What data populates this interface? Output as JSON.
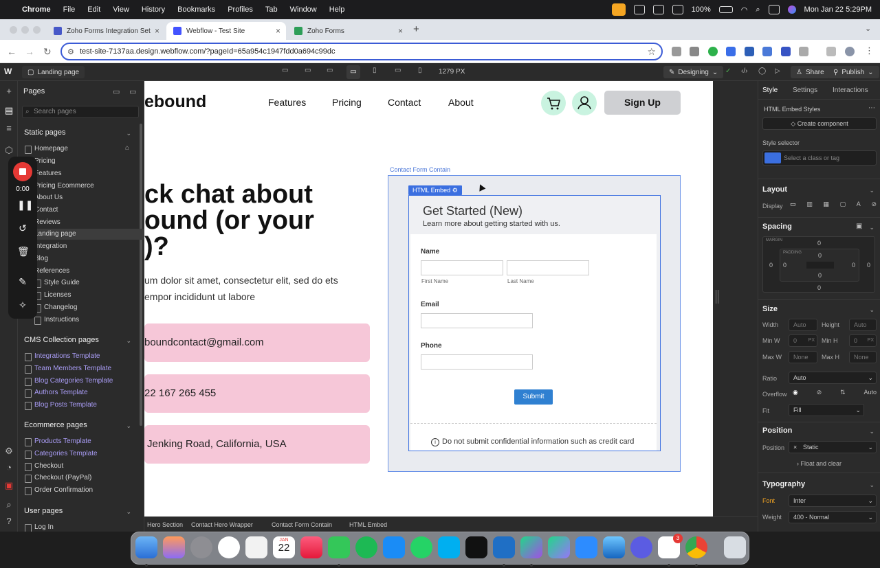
{
  "menubar": {
    "app": "Chrome",
    "items": [
      "File",
      "Edit",
      "View",
      "History",
      "Bookmarks",
      "Profiles",
      "Tab",
      "Window",
      "Help"
    ],
    "battery": "100%",
    "datetime": "Mon Jan 22  5:29PM"
  },
  "browser": {
    "tabs": [
      {
        "title": "Zoho Forms Integration Setup",
        "color": "#4758c8"
      },
      {
        "title": "Webflow - Test Site",
        "color": "#4353ff"
      },
      {
        "title": "Zoho Forms",
        "color": "#2e9e58"
      }
    ],
    "url": "test-site-7137aa.design.webflow.com/?pageId=65a954c1947fdd0a694c99dc"
  },
  "webflow_top": {
    "page": "Landing page",
    "width": "1279 PX",
    "mode": "Designing",
    "share": "Share",
    "publish": "Publish"
  },
  "pages_panel": {
    "title": "Pages",
    "search_placeholder": "Search pages",
    "static_title": "Static pages",
    "static": [
      "Homepage",
      "Pricing",
      "Features",
      "Pricing Ecommerce",
      "About Us",
      "Contact",
      "Reviews",
      "Landing page",
      "Integration",
      "Blog",
      "References"
    ],
    "static_sub": [
      "Style Guide",
      "Licenses",
      "Changelog",
      "Instructions"
    ],
    "cms_title": "CMS Collection pages",
    "cms": [
      "Integrations Template",
      "Team Members Template",
      "Blog Categories Template",
      "Authors Template",
      "Blog Posts Template"
    ],
    "ecom_title": "Ecommerce pages",
    "ecom_cms": [
      "Products Template",
      "Categories Template"
    ],
    "ecom": [
      "Checkout",
      "Checkout (PayPal)",
      "Order Confirmation"
    ],
    "user_title": "User pages",
    "user": [
      "Log In"
    ]
  },
  "recording": {
    "time": "0:00"
  },
  "site": {
    "logo": "ebound",
    "nav": [
      "Features",
      "Pricing",
      "Contact",
      "About"
    ],
    "signup": "Sign Up",
    "hero_lines": [
      "ck chat about",
      "ound (or your",
      ")?"
    ],
    "lorem_lines": [
      "um dolor sit amet, consectetur elit, sed do ets",
      "empor incididunt ut labore"
    ],
    "cards": [
      "boundcontact@gmail.com",
      "22 167 265 455",
      "Jenking Road, California, USA"
    ],
    "container_label": "Contact Form Contain",
    "embed_label": "HTML Embed"
  },
  "form": {
    "title": "Get Started (New)",
    "subtitle": "Learn more about getting started with us.",
    "name_label": "Name",
    "first": "First Name",
    "last": "Last Name",
    "email_label": "Email",
    "phone_label": "Phone",
    "submit": "Submit",
    "notice": "Do not submit confidential information such as credit card"
  },
  "breadcrumbs": [
    "Hero Section",
    "Contact Hero Wrapper",
    "Contact Form Contain",
    "HTML Embed"
  ],
  "right_panel": {
    "tabs": [
      "Style",
      "Settings",
      "Interactions"
    ],
    "embed_styles": "HTML Embed Styles",
    "create_component": "Create component",
    "style_selector": "Style selector",
    "class_placeholder": "Select a class or tag",
    "layout": "Layout",
    "display": "Display",
    "spacing": "Spacing",
    "margin": "MARGIN",
    "padding": "PADDING",
    "spacing_values": [
      "0",
      "0",
      "0",
      "0",
      "0",
      "0",
      "0",
      "0"
    ],
    "size": "Size",
    "width": "Width",
    "height": "Height",
    "min_w": "Min W",
    "min_h": "Min H",
    "max_w": "Max W",
    "max_h": "Max H",
    "auto": "Auto",
    "none": "None",
    "zero": "0",
    "px": "PX",
    "ratio": "Ratio",
    "ratio_val": "Auto",
    "overflow": "Overflow",
    "overflow_auto": "Auto",
    "fit": "Fit",
    "fit_val": "Fill",
    "position": "Position",
    "position_val": "Static",
    "float": "Float and clear",
    "typography": "Typography",
    "font": "Font",
    "font_val": "Inter",
    "weight": "Weight",
    "weight_val": "400 - Normal"
  },
  "dock": {
    "calendar_month": "JAN",
    "calendar_day": "22",
    "slack_badge": "3"
  },
  "colors": {
    "accent": "#3b6fe0",
    "card": "#f6c7d8",
    "mint": "#c9f3e0"
  }
}
